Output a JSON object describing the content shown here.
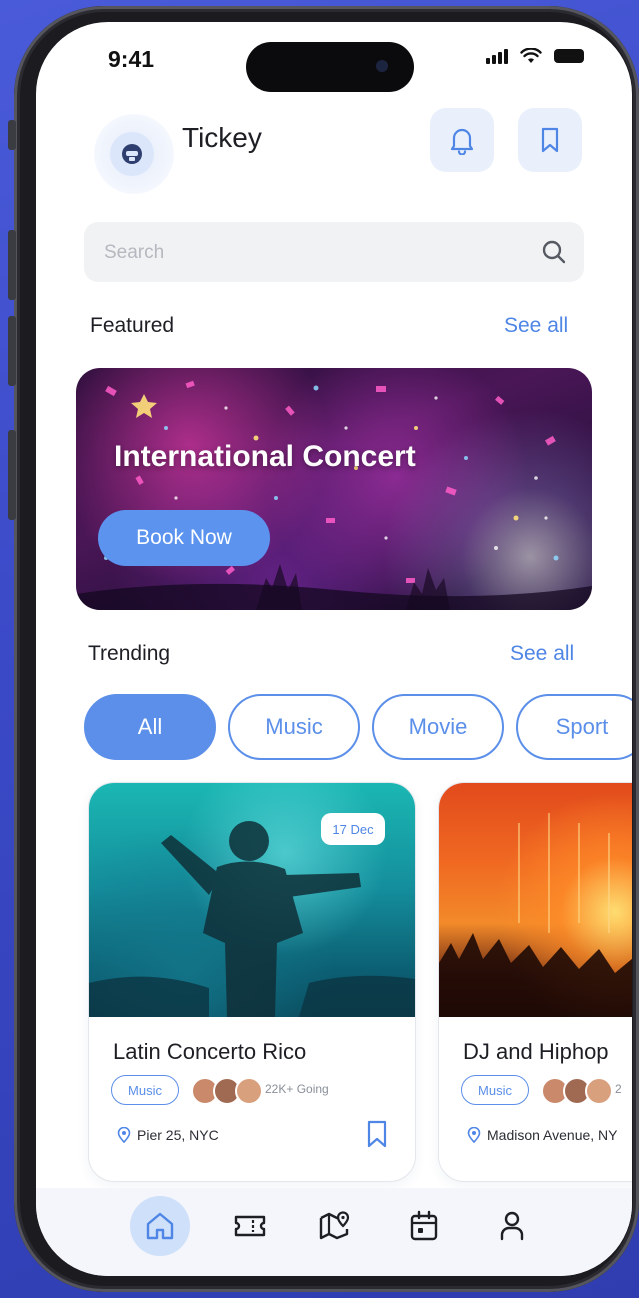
{
  "status_bar": {
    "time": "9:41"
  },
  "header": {
    "app_name": "Tickey",
    "icons": [
      "tickey-logo-icon",
      "bell-icon",
      "bookmark-icon"
    ]
  },
  "search": {
    "placeholder": "Search",
    "value": "",
    "icon": "search-icon"
  },
  "featured": {
    "section_title": "Featured",
    "see_all_label": "See all",
    "banner_title": "International Concert",
    "book_label": "Book Now"
  },
  "trending": {
    "section_title": "Trending",
    "see_all_label": "See all",
    "categories": [
      {
        "label": "All",
        "active": true
      },
      {
        "label": "Music",
        "active": false
      },
      {
        "label": "Movie",
        "active": false
      },
      {
        "label": "Sport",
        "active": false
      }
    ],
    "events": [
      {
        "title": "Latin Concerto Rico",
        "date": "17 Dec",
        "tag": "Music",
        "going": "22K+ Going",
        "location": "Pier 25, NYC"
      },
      {
        "title": "DJ and Hiphop",
        "date": "",
        "tag": "Music",
        "going": "2",
        "location": "Madison Avenue, NY"
      }
    ]
  },
  "bottom_nav": {
    "items": [
      "home-icon",
      "ticket-icon",
      "map-icon",
      "calendar-icon",
      "profile-icon"
    ],
    "active": "home-icon"
  },
  "colors": {
    "accent": "#5b8fe9",
    "link": "#4f86e6",
    "background": "#3a49c6",
    "chip_active_bg": "#5b8fe9",
    "icon_button_bg": "#e9f0fc"
  }
}
